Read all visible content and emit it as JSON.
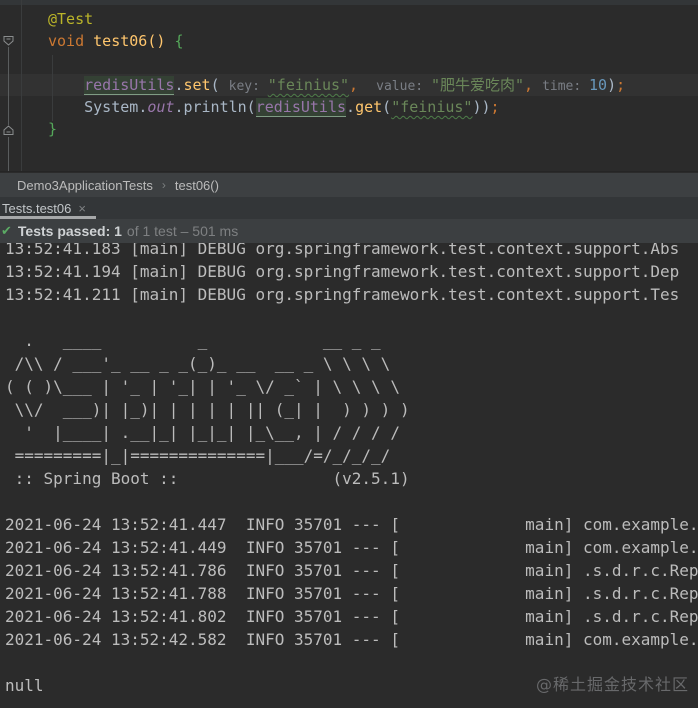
{
  "editor": {
    "caret_line_index": 3,
    "code_lines": [
      {
        "tokens": [
          {
            "t": "@Test",
            "c": "ann"
          }
        ]
      },
      {
        "tokens": [
          {
            "t": "void ",
            "c": "kw"
          },
          {
            "t": "test06",
            "c": "mdecl"
          },
          {
            "t": "() ",
            "c": "mdecl"
          },
          {
            "t": "{",
            "c": "brace"
          }
        ]
      },
      {
        "tokens": []
      },
      {
        "tokens": [
          {
            "t": "    ",
            "c": "plain"
          },
          {
            "t": "",
            "c": "caret"
          },
          {
            "t": "redisUtils",
            "c": "field"
          },
          {
            "t": ".",
            "c": "plain"
          },
          {
            "t": "set",
            "c": "mcall"
          },
          {
            "t": "( ",
            "c": "plain"
          },
          {
            "t": "key: ",
            "c": "hint"
          },
          {
            "t": "\"feinius\"",
            "c": "strw"
          },
          {
            "t": ",  ",
            "c": "pun"
          },
          {
            "t": "value: ",
            "c": "hint"
          },
          {
            "t": "\"肥牛爱吃肉\"",
            "c": "str"
          },
          {
            "t": ", ",
            "c": "pun"
          },
          {
            "t": "time: ",
            "c": "hint"
          },
          {
            "t": "10",
            "c": "num"
          },
          {
            "t": ")",
            "c": "plain"
          },
          {
            "t": ";",
            "c": "pun"
          }
        ]
      },
      {
        "tokens": [
          {
            "t": "    ",
            "c": "plain"
          },
          {
            "t": "System",
            "c": "plain"
          },
          {
            "t": ".",
            "c": "plain"
          },
          {
            "t": "out",
            "c": "out"
          },
          {
            "t": ".println(",
            "c": "plain"
          },
          {
            "t": "redisUtils",
            "c": "field"
          },
          {
            "t": ".",
            "c": "plain"
          },
          {
            "t": "get",
            "c": "mcall"
          },
          {
            "t": "(",
            "c": "plain"
          },
          {
            "t": "\"feinius\"",
            "c": "strw"
          },
          {
            "t": "))",
            "c": "plain"
          },
          {
            "t": ";",
            "c": "pun"
          }
        ]
      },
      {
        "tokens": [
          {
            "t": "}",
            "c": "brace"
          }
        ]
      }
    ]
  },
  "breadcrumb": {
    "class_name": "Demo3ApplicationTests",
    "separator": "›",
    "method_name": "test06()"
  },
  "test_tab": {
    "label": "Tests.test06",
    "close_icon": "×"
  },
  "test_status": {
    "check_icon": "✔",
    "passed_label": "Tests passed: 1",
    "detail": "of 1 test – 501 ms"
  },
  "console": {
    "lines": [
      "13:52:41.183 [main] DEBUG org.springframework.test.context.support.Abs",
      "13:52:41.194 [main] DEBUG org.springframework.test.context.support.Dep",
      "13:52:41.211 [main] DEBUG org.springframework.test.context.support.Tes",
      "",
      "  .   ____          _            __ _ _",
      " /\\\\ / ___'_ __ _ _(_)_ __  __ _ \\ \\ \\ \\",
      "( ( )\\___ | '_ | '_| | '_ \\/ _` | \\ \\ \\ \\",
      " \\\\/  ___)| |_)| | | | | || (_| |  ) ) ) )",
      "  '  |____| .__|_| |_|_| |_\\__, | / / / /",
      " =========|_|==============|___/=/_/_/_/",
      " :: Spring Boot ::                (v2.5.1)",
      "",
      "2021-06-24 13:52:41.447  INFO 35701 --- [             main] com.example.",
      "2021-06-24 13:52:41.449  INFO 35701 --- [             main] com.example.",
      "2021-06-24 13:52:41.786  INFO 35701 --- [             main] .s.d.r.c.Rep",
      "2021-06-24 13:52:41.788  INFO 35701 --- [             main] .s.d.r.c.Rep",
      "2021-06-24 13:52:41.802  INFO 35701 --- [             main] .s.d.r.c.Rep",
      "2021-06-24 13:52:42.582  INFO 35701 --- [             main] com.example.",
      "",
      "null"
    ]
  },
  "watermark": "@稀土掘金技术社区",
  "colors": {
    "editor_bg": "#2B2B2B",
    "panel_bg": "#3C3F41",
    "pass_green": "#5bab64",
    "string_green": "#6A8759",
    "keyword_orange": "#CC7832",
    "method_gold": "#FFC66D",
    "field_purple": "#9876AA",
    "number_blue": "#6897BB",
    "annotation_yellow": "#BBB529"
  }
}
